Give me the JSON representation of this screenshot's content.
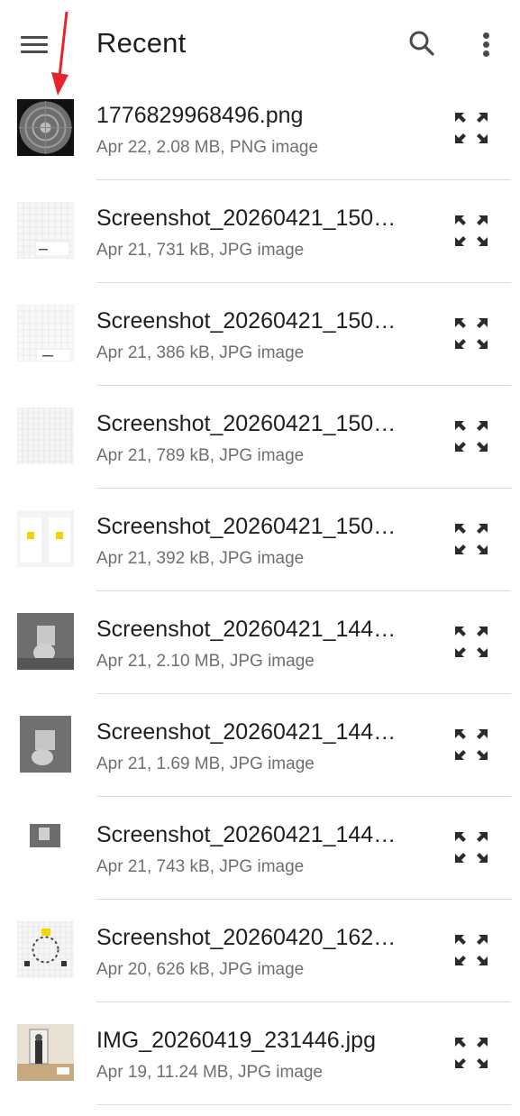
{
  "appbar": {
    "title": "Recent",
    "menu_icon": "hamburger-menu-icon",
    "search_icon": "search-icon",
    "more_icon": "more-vert-icon"
  },
  "colors": {
    "text_primary": "#1f1f1f",
    "text_secondary": "#6f6f6f",
    "icon": "#4a4a4a",
    "divider": "#dcdcdc",
    "annotation_arrow": "#e8232a"
  },
  "files": [
    {
      "name": "1776829968496.png",
      "meta": "Apr 22, 2.08 MB, PNG image",
      "thumb": "dark-radial"
    },
    {
      "name": "Screenshot_20260421_150…",
      "meta": "Apr 21, 731 kB, JPG image",
      "thumb": "grid-card"
    },
    {
      "name": "Screenshot_20260421_150…",
      "meta": "Apr 21, 386 kB, JPG image",
      "thumb": "grid-light"
    },
    {
      "name": "Screenshot_20260421_150…",
      "meta": "Apr 21, 789 kB, JPG image",
      "thumb": "grid-plain"
    },
    {
      "name": "Screenshot_20260421_150…",
      "meta": "Apr 21, 392 kB, JPG image",
      "thumb": "yellow-cards"
    },
    {
      "name": "Screenshot_20260421_144…",
      "meta": "Apr 21, 2.10 MB, JPG image",
      "thumb": "photo-gray"
    },
    {
      "name": "Screenshot_20260421_144…",
      "meta": "Apr 21, 1.69 MB, JPG image",
      "thumb": "photo-gray-2"
    },
    {
      "name": "Screenshot_20260421_144…",
      "meta": "Apr 21, 743 kB, JPG image",
      "thumb": "photo-small"
    },
    {
      "name": "Screenshot_20260420_162…",
      "meta": "Apr 20, 626 kB, JPG image",
      "thumb": "dial-grid"
    },
    {
      "name": "IMG_20260419_231446.jpg",
      "meta": "Apr 19, 11.24 MB, JPG image",
      "thumb": "photo-room"
    }
  ],
  "row_action_icon": "expand-icon"
}
